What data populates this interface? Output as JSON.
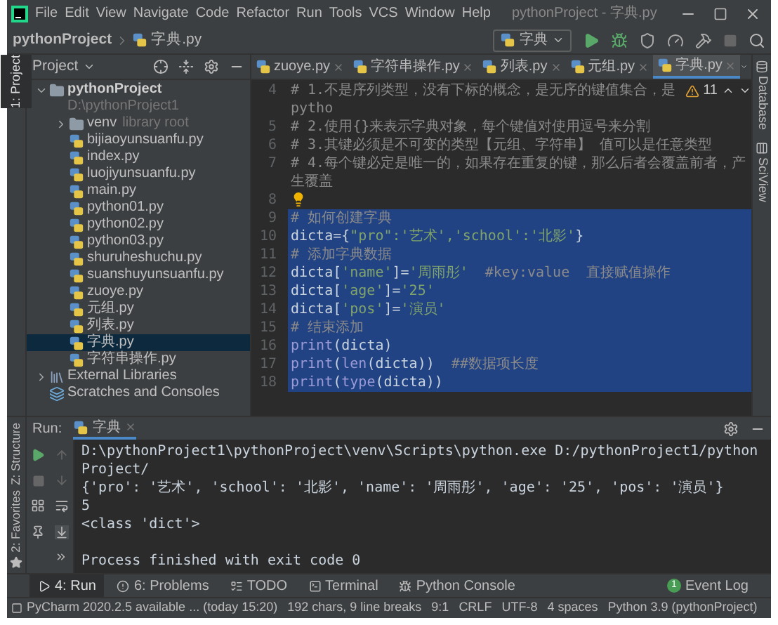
{
  "window": {
    "title": "pythonProject - 字典.py"
  },
  "menu": [
    "File",
    "Edit",
    "View",
    "Navigate",
    "Code",
    "Refactor",
    "Run",
    "Tools",
    "VCS",
    "Window",
    "Help"
  ],
  "breadcrumb": [
    "pythonProject",
    "字典.py"
  ],
  "run_config": {
    "label": "字典"
  },
  "left_strip": [
    {
      "label": "1: Project",
      "selected": true
    },
    {
      "label": "Z: Structure",
      "selected": false
    },
    {
      "label": "2: Favorites",
      "selected": false
    }
  ],
  "right_strip": [
    {
      "label": "Database"
    },
    {
      "label": "SciView"
    }
  ],
  "project": {
    "title": "Project",
    "tree": [
      {
        "label": "pythonProject",
        "note": "D:\\pythonProject1",
        "kind": "folder",
        "expanded": true,
        "selected": false,
        "children": [
          {
            "label": "venv",
            "note": "library root",
            "kind": "folder",
            "expanded": false,
            "selected": false
          },
          {
            "label": "bijiaoyunsuanfu.py",
            "kind": "python",
            "selected": false
          },
          {
            "label": "index.py",
            "kind": "python",
            "selected": false
          },
          {
            "label": "luojiyunsuanfu.py",
            "kind": "python",
            "selected": false
          },
          {
            "label": "main.py",
            "kind": "python",
            "selected": false
          },
          {
            "label": "python01.py",
            "kind": "python",
            "selected": false
          },
          {
            "label": "python02.py",
            "kind": "python",
            "selected": false
          },
          {
            "label": "python03.py",
            "kind": "python",
            "selected": false
          },
          {
            "label": "shuruheshuchu.py",
            "kind": "python",
            "selected": false
          },
          {
            "label": "suanshuyunsuanfu.py",
            "kind": "python",
            "selected": false
          },
          {
            "label": "zuoye.py",
            "kind": "python",
            "selected": false
          },
          {
            "label": "元组.py",
            "kind": "python",
            "selected": false
          },
          {
            "label": "列表.py",
            "kind": "python",
            "selected": false
          },
          {
            "label": "字典.py",
            "kind": "python",
            "selected": true
          },
          {
            "label": "字符串操作.py",
            "kind": "python",
            "selected": false
          }
        ]
      },
      {
        "label": "External Libraries",
        "kind": "libraries",
        "expanded": false,
        "selected": false
      },
      {
        "label": "Scratches and Consoles",
        "kind": "scratches",
        "selected": false
      }
    ]
  },
  "editor_tabs": [
    {
      "label": "zuoye.py",
      "selected": false
    },
    {
      "label": "字符串操作.py",
      "selected": false
    },
    {
      "label": "列表.py",
      "selected": false
    },
    {
      "label": "元组.py",
      "selected": false
    },
    {
      "label": "字典.py",
      "selected": true
    }
  ],
  "inspections": {
    "count": "11"
  },
  "code_lines": [
    {
      "number": "4",
      "selected": false,
      "tokens": [
        {
          "text": "# 1.不是序列类型，没有下标的概念，是无序的键值集合，是pytho",
          "kind": "comment"
        }
      ]
    },
    {
      "number": "5",
      "selected": false,
      "tokens": [
        {
          "text": "# 2.使用{}来表示字典对象，每个键值对使用逗号来分割",
          "kind": "comment"
        }
      ]
    },
    {
      "number": "6",
      "selected": false,
      "tokens": [
        {
          "text": "# 3.其键必须是不可变的类型【元组、字符串】 值可以是任意类型",
          "kind": "comment"
        }
      ]
    },
    {
      "number": "7",
      "selected": false,
      "tokens": [
        {
          "text": "# 4.每个键必定是唯一的，如果存在重复的键，那么后者会覆盖前者，产生覆盖",
          "kind": "comment"
        }
      ]
    },
    {
      "number": "8",
      "selected": false,
      "bulb": true
    },
    {
      "number": "9",
      "selected": true,
      "tokens": [
        {
          "text": "# 如何创建字典",
          "kind": "comment"
        }
      ]
    },
    {
      "number": "10",
      "selected": true,
      "tokens": [
        {
          "text": "dicta={",
          "kind": "plain"
        },
        {
          "text": "\"pro\":'艺术','school':'北影'",
          "kind": "string"
        },
        {
          "text": "}",
          "kind": "plain"
        }
      ]
    },
    {
      "number": "11",
      "selected": true,
      "tokens": [
        {
          "text": "# 添加字典数据",
          "kind": "comment"
        }
      ]
    },
    {
      "number": "12",
      "selected": true,
      "tokens": [
        {
          "text": "dicta[",
          "kind": "plain"
        },
        {
          "text": "'name'",
          "kind": "string"
        },
        {
          "text": "]=",
          "kind": "plain"
        },
        {
          "text": "'周雨彤'  ",
          "kind": "string"
        },
        {
          "text": "#key:value  直接赋值操作",
          "kind": "comment"
        }
      ]
    },
    {
      "number": "13",
      "selected": true,
      "tokens": [
        {
          "text": "dicta[",
          "kind": "plain"
        },
        {
          "text": "'age'",
          "kind": "string"
        },
        {
          "text": "]=",
          "kind": "plain"
        },
        {
          "text": "'25'",
          "kind": "string"
        }
      ]
    },
    {
      "number": "14",
      "selected": true,
      "tokens": [
        {
          "text": "dicta[",
          "kind": "plain"
        },
        {
          "text": "'pos'",
          "kind": "string"
        },
        {
          "text": "]=",
          "kind": "plain"
        },
        {
          "text": "'演员'",
          "kind": "string"
        }
      ]
    },
    {
      "number": "15",
      "selected": true,
      "tokens": [
        {
          "text": "# 结束添加",
          "kind": "comment"
        }
      ]
    },
    {
      "number": "16",
      "selected": true,
      "tokens": [
        {
          "text": "print",
          "kind": "builtin"
        },
        {
          "text": "(dicta)",
          "kind": "plain"
        }
      ]
    },
    {
      "number": "17",
      "selected": true,
      "tokens": [
        {
          "text": "print",
          "kind": "builtin"
        },
        {
          "text": "(",
          "kind": "plain"
        },
        {
          "text": "len",
          "kind": "builtin"
        },
        {
          "text": "(dicta))  ",
          "kind": "plain"
        },
        {
          "text": "##数据项长度",
          "kind": "comment"
        }
      ]
    },
    {
      "number": "18",
      "selected": true,
      "tokens": [
        {
          "text": "print",
          "kind": "builtin"
        },
        {
          "text": "(",
          "kind": "plain"
        },
        {
          "text": "type",
          "kind": "builtin"
        },
        {
          "text": "(dicta))",
          "kind": "plain"
        }
      ]
    }
  ],
  "run_panel": {
    "label": "Run:",
    "tab": "字典",
    "output": [
      "D:\\pythonProject1\\pythonProject\\venv\\Scripts\\python.exe D:/pythonProject1/pythonProject/",
      "{'pro': '艺术', 'school': '北影', 'name': '周雨彤', 'age': '25', 'pos': '演员'}",
      "5",
      "<class 'dict'>",
      "Process finished with exit code 0"
    ]
  },
  "tool_tabs": [
    {
      "label": "4: Run",
      "kind": "run",
      "selected": true
    },
    {
      "label": "6: Problems",
      "kind": "problems",
      "selected": false
    },
    {
      "label": "TODO",
      "kind": "todo",
      "selected": false
    },
    {
      "label": "Terminal",
      "kind": "terminal",
      "selected": false
    },
    {
      "label": "Python Console",
      "kind": "console",
      "selected": false
    }
  ],
  "event_log": {
    "label": "Event Log",
    "count": "1"
  },
  "status_bar": [
    "PyCharm 2020.2.5 available ... (today 15:20)",
    "192 chars, 9 line breaks",
    "9:1",
    "CRLF",
    "UTF-8",
    "4 spaces",
    "Python 3.9 (pythonProject)"
  ]
}
